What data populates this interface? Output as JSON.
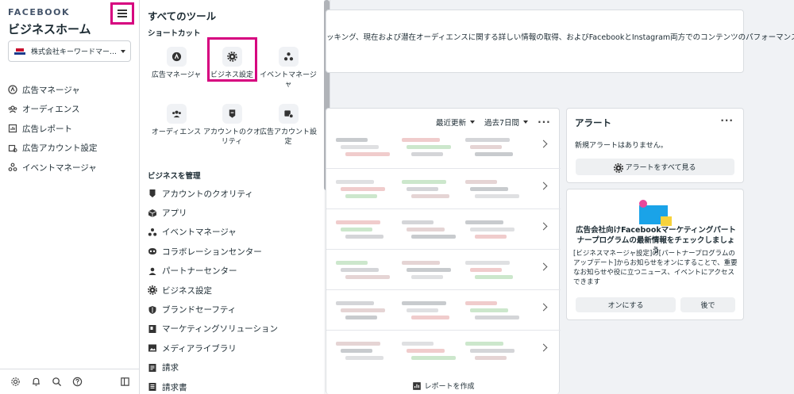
{
  "leftnav": {
    "brand": "FACEBOOK",
    "title": "ビジネスホーム",
    "account": "株式会社キーワードマー…",
    "items": [
      {
        "label": "広告マネージャ",
        "icon": "ads-manager-icon"
      },
      {
        "label": "オーディエンス",
        "icon": "audience-icon"
      },
      {
        "label": "広告レポート",
        "icon": "ad-report-icon"
      },
      {
        "label": "広告アカウント設定",
        "icon": "ad-account-settings-icon"
      },
      {
        "label": "イベントマネージャ",
        "icon": "event-manager-icon"
      }
    ]
  },
  "tools": {
    "title": "すべてのツール",
    "shortcuts_heading": "ショートカット",
    "shortcuts": [
      {
        "label": "広告マネージャ",
        "icon": "ads-manager-icon"
      },
      {
        "label": "ビジネス設定",
        "icon": "gear-icon"
      },
      {
        "label": "イベントマネージャ",
        "icon": "event-manager-icon"
      },
      {
        "label": "オーディエンス",
        "icon": "audience-icon"
      },
      {
        "label": "アカウントのクオリティ",
        "icon": "account-quality-icon"
      },
      {
        "label": "広告アカウント設定",
        "icon": "ad-account-settings-icon"
      }
    ],
    "manage_heading": "ビジネスを管理",
    "manage": [
      {
        "label": "アカウントのクオリティ",
        "icon": "account-quality-icon"
      },
      {
        "label": "アプリ",
        "icon": "app-cube-icon"
      },
      {
        "label": "イベントマネージャ",
        "icon": "event-manager-icon"
      },
      {
        "label": "コラボレーションセンター",
        "icon": "collaboration-icon"
      },
      {
        "label": "パートナーセンター",
        "icon": "partner-icon"
      },
      {
        "label": "ビジネス設定",
        "icon": "gear-icon"
      },
      {
        "label": "ブランドセーフティ",
        "icon": "shield-icon"
      },
      {
        "label": "マーケティングソリューション",
        "icon": "book-icon"
      },
      {
        "label": "メディアライブラリ",
        "icon": "media-library-icon"
      },
      {
        "label": "請求",
        "icon": "billing-icon"
      },
      {
        "label": "請求書",
        "icon": "invoice-icon"
      }
    ]
  },
  "top_card": {
    "text": "ッキング、現在および潜在オーディエンスに関する詳しい情報の取得、およびFacebookとInstagram両方でのコンテンツのパフォーマンスの"
  },
  "main": {
    "sort_label": "最近更新",
    "period_label": "過去7日間",
    "more": "···",
    "create_report": "レポートを作成"
  },
  "alerts": {
    "title": "アラート",
    "more": "···",
    "empty": "新規アラートはありません。",
    "view_all": "アラートをすべて見る"
  },
  "promo": {
    "title": "広告会社向けFacebookマーケティングパートナープログラムの最新情報をチェックしましょう",
    "body": "[ビジネスマネージャ設定]の[パートナープログラムのアップデート]からお知らせをオンにすることで、重要なお知らせや役に立つニュース、イベントにアクセスできます",
    "on_button": "オンにする",
    "later_button": "後で"
  },
  "colors": {
    "highlight": "#d6007f",
    "text": "#1c2b33",
    "background": "#f0f2f5"
  }
}
